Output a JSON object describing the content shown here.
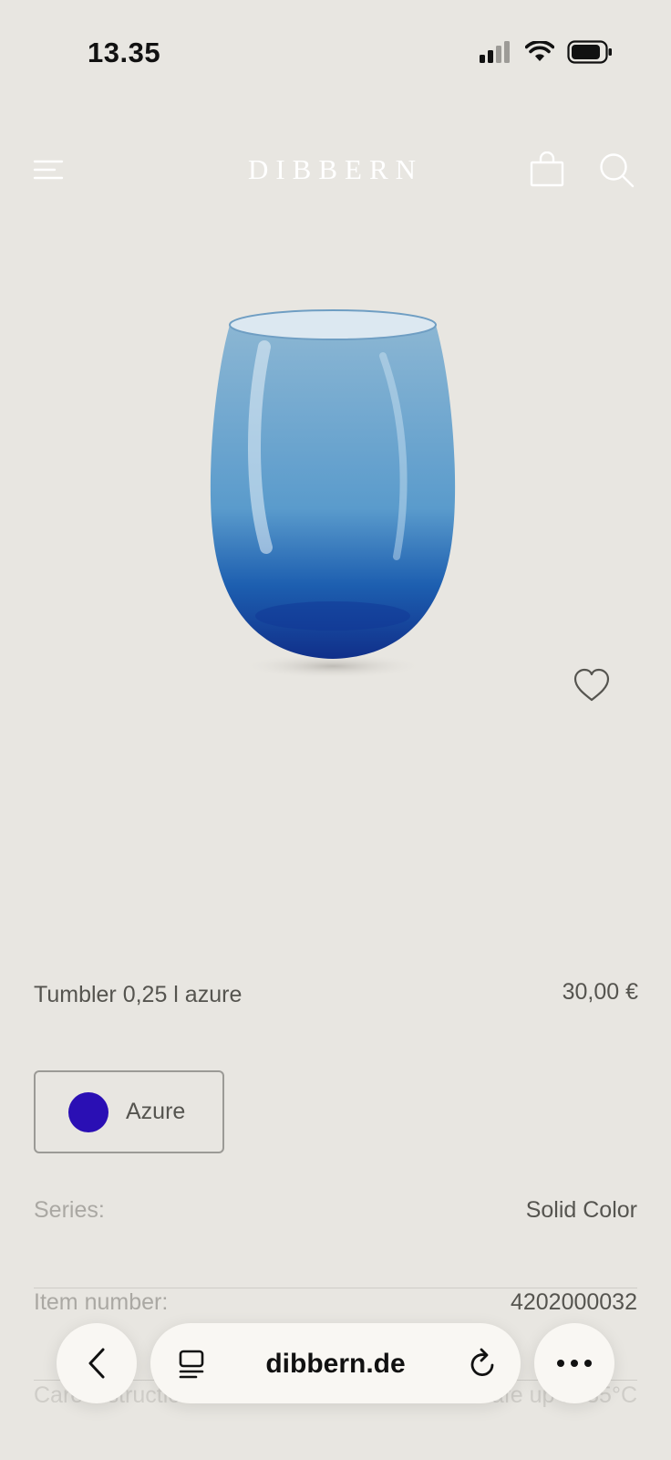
{
  "status_bar": {
    "time": "13.35"
  },
  "header": {
    "brand": "DIBBERN"
  },
  "product": {
    "title": "Tumbler 0,25 l azure",
    "price": "30,00 €",
    "color_option": {
      "label": "Azure",
      "swatch": "#2a0fb4"
    }
  },
  "specs": [
    {
      "label": "Series:",
      "value": "Solid Color"
    },
    {
      "label": "Item number:",
      "value": "4202000032"
    },
    {
      "label": "Care instructions:",
      "value": "Dishwasher safe up to 35°C"
    }
  ],
  "browser": {
    "address": "dibbern.de"
  },
  "colors": {
    "background": "#e8e6e1",
    "brand": "#ffffff",
    "text": "#55544f"
  },
  "icons": [
    "cellular-icon",
    "wifi-icon",
    "battery-icon",
    "menu-icon",
    "bag-icon",
    "search-icon",
    "heart-icon",
    "back-icon",
    "tabs-icon",
    "reload-icon",
    "more-icon"
  ]
}
